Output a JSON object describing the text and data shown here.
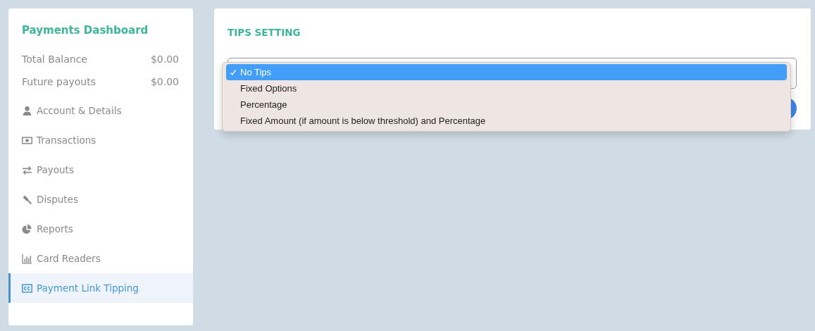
{
  "sidebar": {
    "title": "Payments Dashboard",
    "stats": [
      {
        "label": "Total Balance",
        "value": "$0.00"
      },
      {
        "label": "Future payouts",
        "value": "$0.00"
      }
    ],
    "items": [
      {
        "label": "Account & Details",
        "kind": "user",
        "selected": false
      },
      {
        "label": "Transactions",
        "kind": "money",
        "selected": false
      },
      {
        "label": "Payouts",
        "kind": "exchange",
        "selected": false
      },
      {
        "label": "Disputes",
        "kind": "gavel",
        "selected": false
      },
      {
        "label": "Reports",
        "kind": "pie",
        "selected": false
      },
      {
        "label": "Card Readers",
        "kind": "bars",
        "selected": false
      },
      {
        "label": "Payment Link Tipping",
        "kind": "cc",
        "selected": true
      }
    ]
  },
  "main": {
    "title": "TIPS SETTING",
    "dropdown": {
      "options": [
        {
          "label": "No Tips",
          "selected": true
        },
        {
          "label": "Fixed Options",
          "selected": false
        },
        {
          "label": "Percentage",
          "selected": false
        },
        {
          "label": "Fixed Amount (if amount is below threshold) and Percentage",
          "selected": false
        }
      ]
    }
  }
}
